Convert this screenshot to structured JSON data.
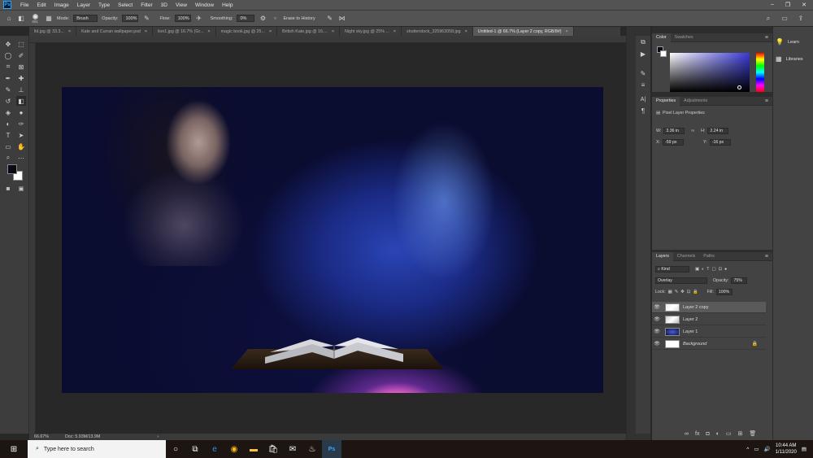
{
  "app": {
    "logo": "Ps"
  },
  "menu": [
    "File",
    "Edit",
    "Image",
    "Layer",
    "Type",
    "Select",
    "Filter",
    "3D",
    "View",
    "Window",
    "Help"
  ],
  "window_controls": [
    "–",
    "❐",
    "✕"
  ],
  "options": {
    "brush_size": "401",
    "mode_label": "Mode:",
    "mode_value": "Brush",
    "opacity_label": "Opacity:",
    "opacity_value": "100%",
    "flow_label": "Flow:",
    "flow_value": "100%",
    "smoothing_label": "Smoothing:",
    "smoothing_value": "0%",
    "erase_history": "Erase to History"
  },
  "tabs": [
    {
      "label": "lld.jpg @ 33.3...",
      "active": false
    },
    {
      "label": "Kate and Curran wallpaper.psd",
      "active": false
    },
    {
      "label": "lion1.jpg @ 16.7% (Gr...",
      "active": false
    },
    {
      "label": "magic book.jpg @ 25...",
      "active": false
    },
    {
      "label": "British Kate.jpg @ 16....",
      "active": false
    },
    {
      "label": "Night sky.jpg @ 25% ...",
      "active": false
    },
    {
      "label": "shutterstock_325963058.jpg",
      "active": false
    },
    {
      "label": "Untitled-1 @ 66.7% (Layer 2 copy, RGB/8#)",
      "active": true
    }
  ],
  "tab_close": "×",
  "status": {
    "zoom": "66.67%",
    "doc": "Doc: 5.93M/13.9M",
    "arrow": "›"
  },
  "color_panel": {
    "tabs": [
      "Color",
      "Swatches"
    ]
  },
  "properties_panel": {
    "tabs": [
      "Properties",
      "Adjustments"
    ],
    "title": "Pixel Layer Properties",
    "w_label": "W:",
    "w_value": "3.36 in",
    "h_label": "H:",
    "h_value": "2.24 in",
    "x_label": "X:",
    "x_value": "-59 px",
    "y_label": "Y:",
    "y_value": "-16 px",
    "link": "∞"
  },
  "layers_panel": {
    "tabs": [
      "Layers",
      "Channels",
      "Paths"
    ],
    "kind": "Kind",
    "blend_mode": "Overlay",
    "opacity_label": "Opacity:",
    "opacity_value": "75%",
    "lock_label": "Lock:",
    "fill_label": "Fill:",
    "fill_value": "100%",
    "layers": [
      {
        "name": "Layer 2 copy",
        "selected": true
      },
      {
        "name": "Layer 2",
        "selected": false
      },
      {
        "name": "Layer 1",
        "selected": false
      },
      {
        "name": "Background",
        "selected": false,
        "locked": true
      }
    ]
  },
  "libraries": {
    "learn": "Learn",
    "libraries": "Libraries"
  },
  "taskbar": {
    "search_placeholder": "Type here to search",
    "time": "10:44 AM",
    "date": "1/11/2020"
  },
  "icons": {
    "eye": "👁",
    "lock": "🔒"
  }
}
